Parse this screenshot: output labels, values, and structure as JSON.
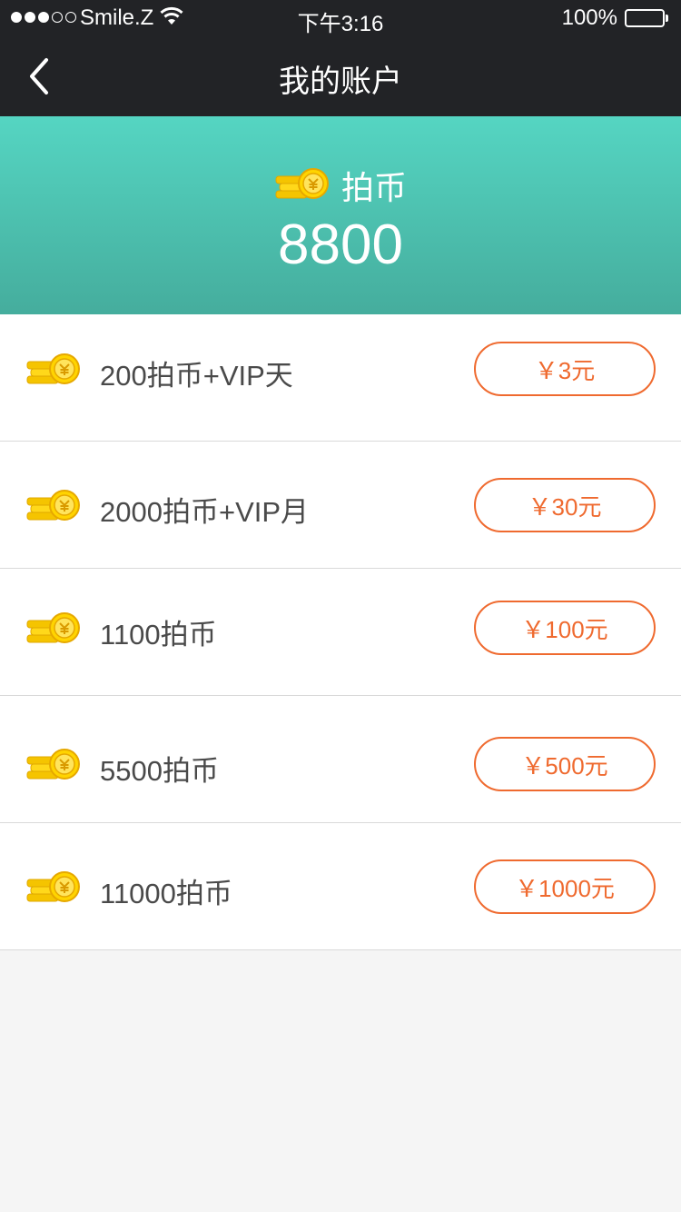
{
  "status_bar": {
    "carrier": "Smile.Z",
    "time": "下午3:16",
    "battery": "100%",
    "signal_filled": 3,
    "signal_total": 5
  },
  "nav": {
    "title": "我的账户",
    "back_icon": "chevron-left-icon"
  },
  "account": {
    "label": "拍币",
    "balance": "8800",
    "icon": "coin-stack-icon"
  },
  "colors": {
    "header_top": "#55d5c2",
    "header_bottom": "#45ad9d",
    "accent": "#ef6a2f",
    "nav_bg": "#222326"
  },
  "packages": [
    {
      "label": "200拍币+VIP天",
      "price": "￥3元"
    },
    {
      "label": "2000拍币+VIP月",
      "price": "￥30元"
    },
    {
      "label": "1100拍币",
      "price": "￥100元"
    },
    {
      "label": "5500拍币",
      "price": "￥500元"
    },
    {
      "label": "11000拍币",
      "price": "￥1000元"
    }
  ]
}
